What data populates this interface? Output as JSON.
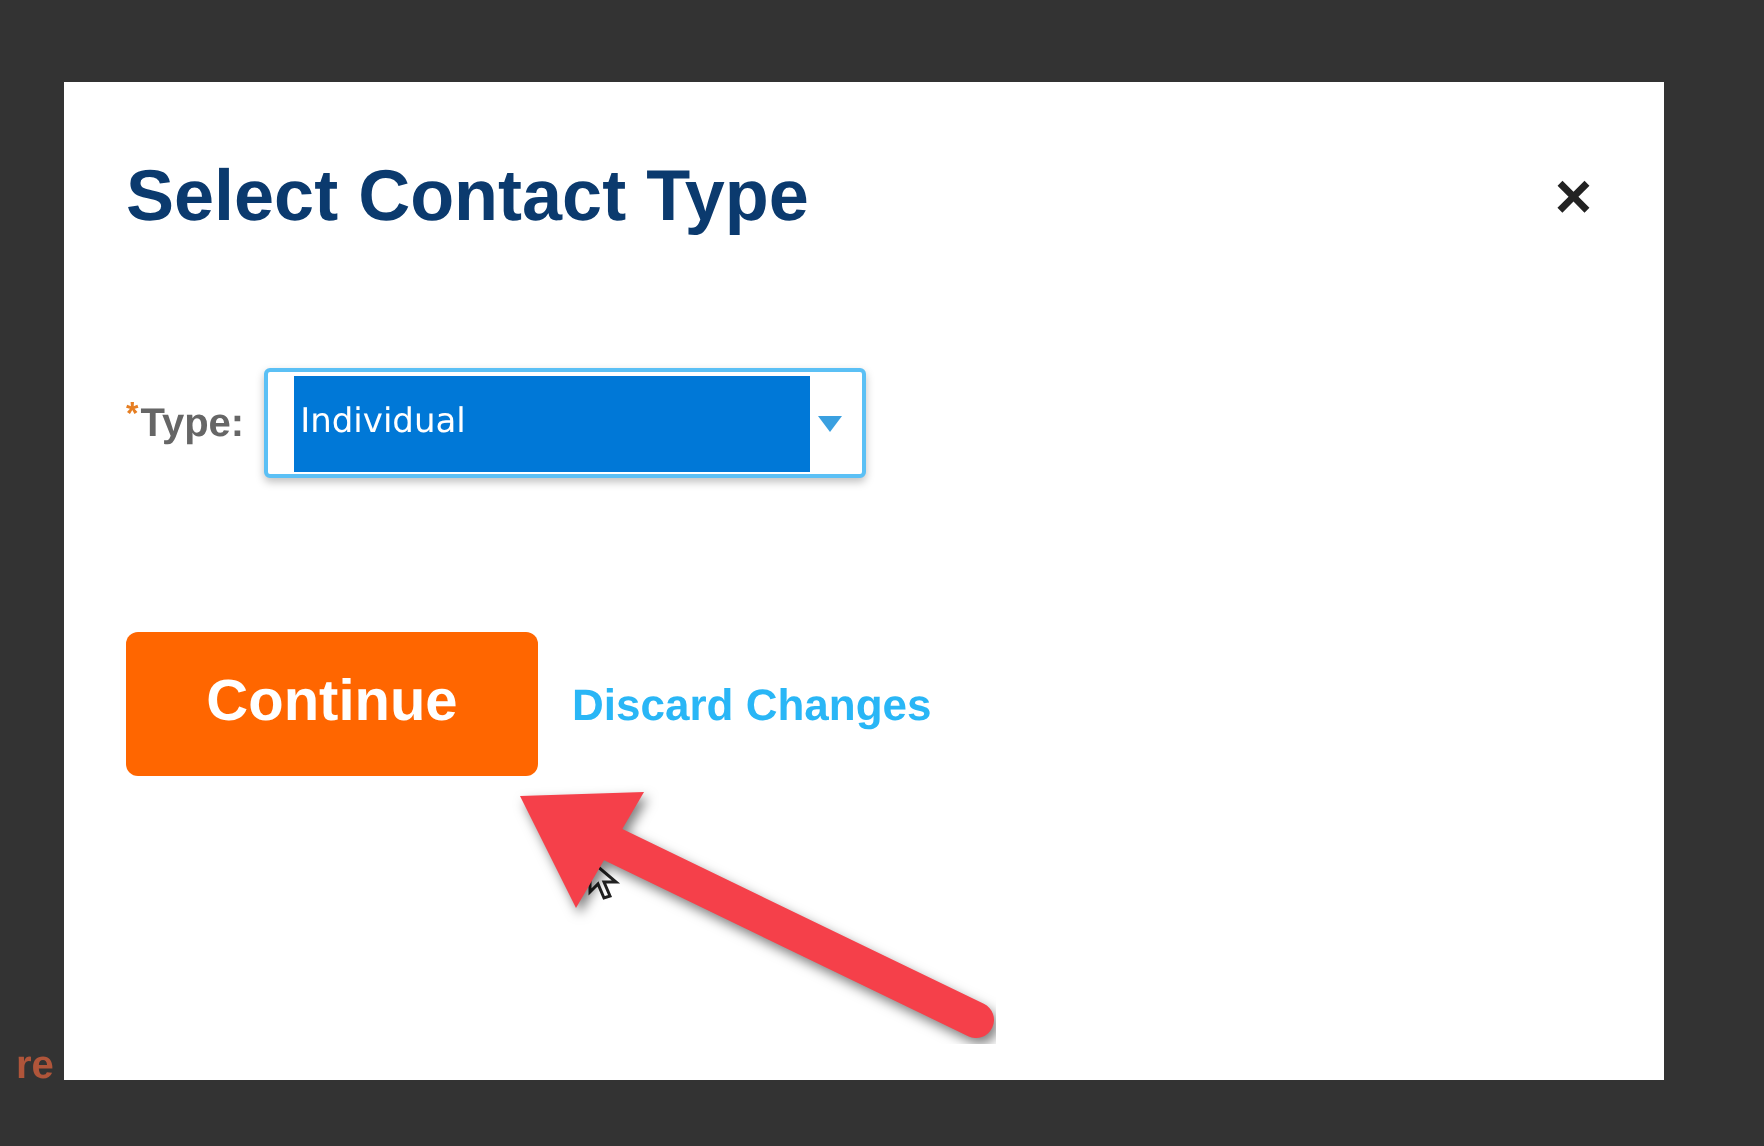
{
  "backdrop": {
    "text_fragment": "re"
  },
  "dialog": {
    "title": "Select Contact Type",
    "close": "×",
    "field": {
      "label": "Type:",
      "required_mark": "*",
      "value": "Individual",
      "selected": true
    },
    "buttons": [
      {
        "kind": "primary",
        "label": "Continue"
      },
      {
        "kind": "link",
        "label": "Discard Changes"
      }
    ]
  }
}
